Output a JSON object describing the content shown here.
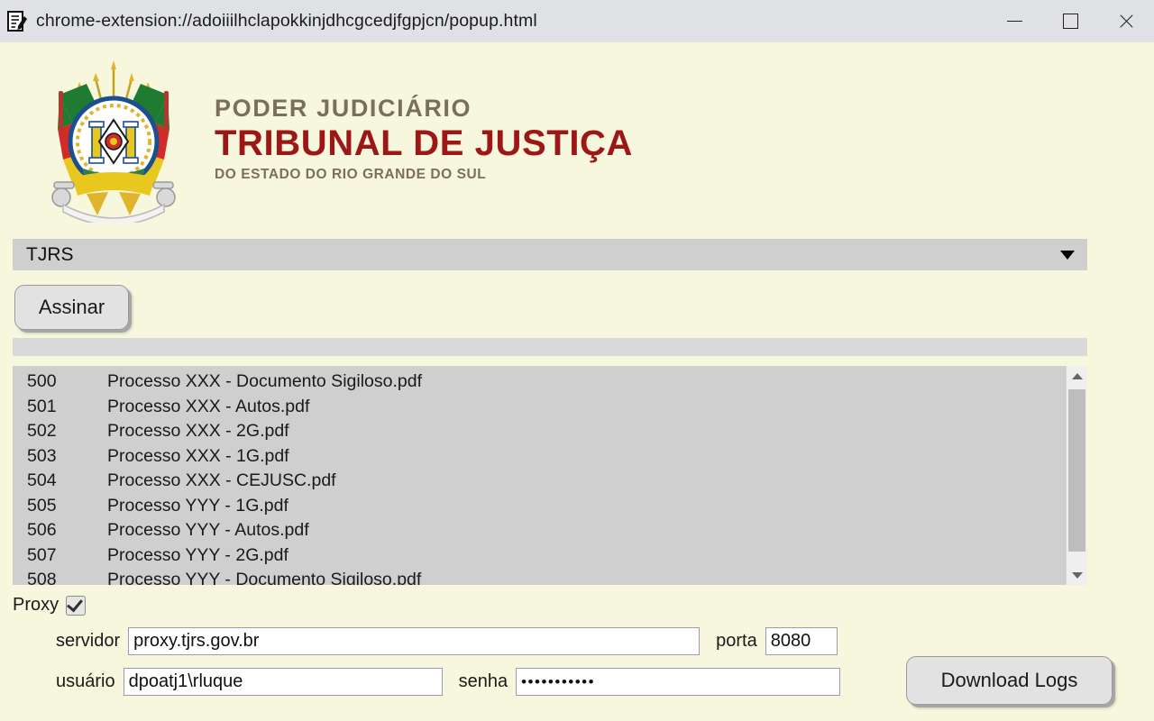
{
  "window": {
    "title": "chrome-extension://adoiiilhclapokkinjdhcgcedjfgpjcn/popup.html",
    "icon": "document-sign-icon",
    "controls": {
      "minimize": "minimize-icon",
      "maximize": "maximize-icon",
      "close": "close-icon"
    },
    "colors": {
      "titlebar_bg": "#dfe1e5",
      "page_bg": "#f7f7dd",
      "brand_red": "#9d1717",
      "brand_brown": "#7a6f5d",
      "control_gray": "#cfcfcf"
    }
  },
  "header": {
    "emblem": "rio-grande-do-sul-coat-of-arms",
    "line1": "PODER JUDICIÁRIO",
    "line2": "TRIBUNAL DE JUSTIÇA",
    "line3": "DO ESTADO DO RIO GRANDE DO SUL"
  },
  "court_select": {
    "value": "TJRS",
    "options": [
      "TJRS"
    ],
    "arrow": "chevron-down-icon"
  },
  "actions": {
    "sign_label": "Assinar",
    "download_logs_label": "Download Logs"
  },
  "progress": {
    "value": 0,
    "max": 100
  },
  "documents": {
    "columns": [
      "id",
      "name"
    ],
    "rows": [
      {
        "id": "500",
        "name": "Processo XXX - Documento Sigiloso.pdf"
      },
      {
        "id": "501",
        "name": "Processo XXX - Autos.pdf"
      },
      {
        "id": "502",
        "name": "Processo XXX - 2G.pdf"
      },
      {
        "id": "503",
        "name": "Processo XXX - 1G.pdf"
      },
      {
        "id": "504",
        "name": "Processo XXX - CEJUSC.pdf"
      },
      {
        "id": "505",
        "name": "Processo YYY - 1G.pdf"
      },
      {
        "id": "506",
        "name": "Processo YYY - Autos.pdf"
      },
      {
        "id": "507",
        "name": "Processo YYY - 2G.pdf"
      },
      {
        "id": "508",
        "name": "Processo YYY - Documento Sigiloso.pdf"
      }
    ],
    "scrollbar": {
      "up": "triangle-up-icon",
      "down": "triangle-down-icon"
    }
  },
  "proxy": {
    "label": "Proxy",
    "enabled": true,
    "fields": {
      "servidor": {
        "label": "servidor",
        "value": "proxy.tjrs.gov.br",
        "placeholder": ""
      },
      "porta": {
        "label": "porta",
        "value": "8080",
        "placeholder": ""
      },
      "usuario": {
        "label": "usuário",
        "value": "dpoatj1\\rluque",
        "placeholder": ""
      },
      "senha": {
        "label": "senha",
        "value": "•••••••••••",
        "placeholder": ""
      }
    }
  }
}
